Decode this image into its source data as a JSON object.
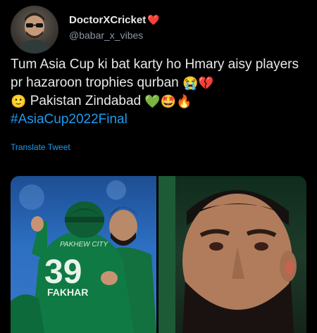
{
  "author": {
    "display_name": "DoctorXCricket",
    "heart_emoji": "❤️",
    "handle": "@babar_x_vibes",
    "avatar_icon": "profile-avatar-icon"
  },
  "tweet": {
    "line1": "Tum Asia Cup ki bat karty ho Hmary aisy players pr hazaroon trophies qurban",
    "emoji_cry": "😭",
    "emoji_broken_heart": "💔",
    "emoji_smile": "🙂",
    "line2": "Pakistan Zindabad",
    "emoji_green_heart": "💚",
    "emoji_star_eyes": "🤩",
    "emoji_fire": "🔥",
    "hashtag": "#AsiaCup2022Final"
  },
  "translate_label": "Translate Tweet",
  "media": {
    "left_jersey_number": "39",
    "left_jersey_name": "FAKHAR",
    "left_jersey_sponsor": "PAKHEW CITY"
  },
  "colors": {
    "background": "#000000",
    "text": "#e7e9ea",
    "secondary": "#8b98a5",
    "link": "#1d9bf0",
    "heart": "#f4212e"
  }
}
